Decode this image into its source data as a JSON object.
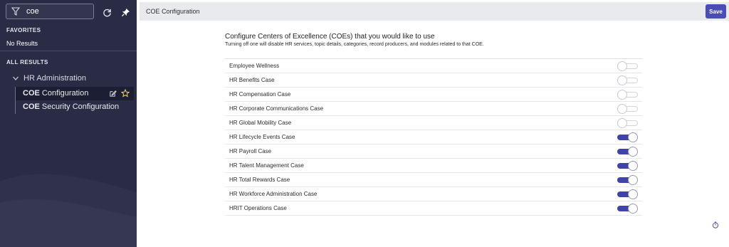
{
  "sidebar": {
    "filter": {
      "value": "coe",
      "icon": "filter-icon"
    },
    "refresh_icon": "refresh-icon",
    "pin_icon": "pin-icon",
    "favorites_label": "FAVORITES",
    "no_results": "No Results",
    "all_results_label": "ALL RESULTS",
    "group": {
      "label": "HR Administration",
      "expanded": true
    },
    "items": [
      {
        "highlight": "COE",
        "rest": " Configuration",
        "active": true
      },
      {
        "highlight": "COE",
        "rest": " Security Configuration",
        "active": false
      }
    ],
    "colors": {
      "background": "#2a2c45",
      "active_item": "#1c1e33"
    }
  },
  "header": {
    "title": "COE Configuration",
    "save_label": "Save"
  },
  "main": {
    "heading": "Configure Centers of Excellence (COEs) that you would like to use",
    "subheading": "Turning off one will disable HR services, topic details, categories, record producers, and modules related to that COE.",
    "coes": [
      {
        "label": "Employee Wellness",
        "enabled": false
      },
      {
        "label": "HR Benefits Case",
        "enabled": false
      },
      {
        "label": "HR Compensation Case",
        "enabled": false
      },
      {
        "label": "HR Corporate Communications Case",
        "enabled": false
      },
      {
        "label": "HR Global Mobility Case",
        "enabled": false
      },
      {
        "label": "HR Lifecycle Events Case",
        "enabled": true
      },
      {
        "label": "HR Payroll Case",
        "enabled": true
      },
      {
        "label": "HR Talent Management Case",
        "enabled": true
      },
      {
        "label": "HR Total Rewards Case",
        "enabled": true
      },
      {
        "label": "HR Workforce Administration Case",
        "enabled": true
      },
      {
        "label": "HRIT Operations Case",
        "enabled": true
      }
    ],
    "colors": {
      "toggle_on": "#3f44a6",
      "save_button": "#4a4db3"
    }
  },
  "footer": {
    "timer_icon": "timer-icon"
  }
}
